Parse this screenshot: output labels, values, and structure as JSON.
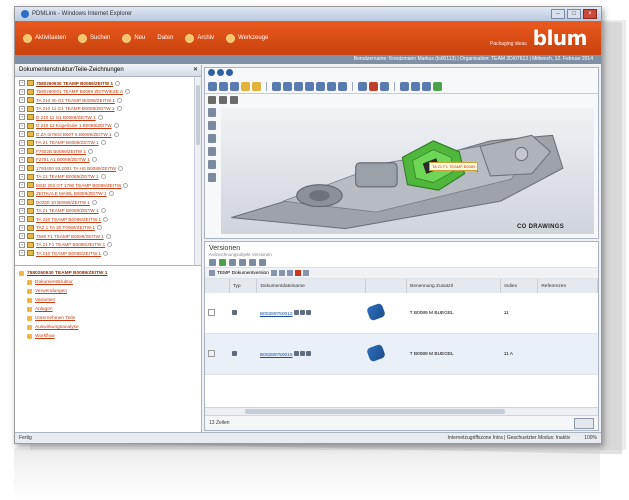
{
  "window": {
    "title": "PDMLink - Windows Internet Explorer"
  },
  "topbar": {
    "menu": [
      {
        "label": "Aktivitaeten"
      },
      {
        "label": "Suchen"
      },
      {
        "label": "Neu"
      },
      {
        "label": "Daten"
      },
      {
        "label": "Archiv"
      },
      {
        "label": "Werkzeuge"
      }
    ],
    "tagline": "Packaging ideas",
    "logo": "blum",
    "info": "Benutzername: Kreutzmann Markus (lo00113) | Organisation: TEAM 2D/07613 | Mittwoch, 12. Februar 2014"
  },
  "left": {
    "header": "Dokumentenstruktur/Teile-Zeichnungen",
    "tree": [
      "7580260930 TEAMP B0089/ZEITW 1",
      "7580260001 TEAMP B0089 ZEITWIEZE A",
      "TA 210 30 G1 TEAMP B0089/ZEITW 1",
      "TA 210 11 G1 TEAMP B0089/ZEITW 1",
      "D 210 11 G1 B0089/ZEITW 1",
      "D 210 12 Kugelzuler 1 B0089/ZEITW",
      "D.ZA 0/7503 B00T 5 B0089/ZEITW 1",
      "FA 21 TEAMP B0089/ZEITW 1",
      "F7502B B0089/ZEITW 1",
      "F2781 A1 B0089/ZEITW 1",
      "1793400 93.2001 TA HS B0089/ZEITW",
      "TA 21 TEAMP B0089/ZEITW 1",
      "MSD 202 GT 1780 TEAMP B0089/ZEITW",
      "ZEITKALE MA/BL B0089/ZEITW 1",
      "D0200 10 B0089/ZEITW 1",
      "TA 21 TEAMP B0089/ZEITW 1",
      "TA 210 TEAMP B0089/ZEITW 1",
      "TAZ 1 FA 30 F0089/ZEITW 1",
      "7580 F1 TEAMP B0089/ZEITW 1",
      "TA 21 F1 TEAMP B0089/ZEITW 1",
      "TA 210 TEAMP B0089/ZEITW 1"
    ],
    "tree2": {
      "root": "7580260930 TEAMP B0089/ZEITW 1",
      "items": [
        "Dokumentstruktur",
        "Verwendungen",
        "Varianten",
        "Anlagen",
        "Unternehmen Teile",
        "Auswirkungsanalyse",
        "Workflow"
      ]
    }
  },
  "viewer": {
    "callout": "TA 21 F1 TEAMP B0089",
    "watermark": "CO DRAWINGS"
  },
  "versions": {
    "title": "Versionen",
    "subtitle": "Aufzeichnungsobjekt Versionen",
    "toolbar_label": "TEMP Dokumentversion",
    "columns": [
      "Typ",
      "Dokumentdateiname",
      "",
      "Benennung Zusatztl",
      "Indiex",
      "Referenzen"
    ],
    "rows": [
      {
        "name": "B00289750012",
        "benennung": "T B0089 M BUEGEL",
        "index": "11"
      },
      {
        "name": "B00289750015",
        "benennung": "T B0089 M BUEGEL",
        "index": "11 A"
      }
    ],
    "footer": "13 Zeilen"
  },
  "statusbar": {
    "left": "Fertig",
    "middle": "Internetzugriffszone Intra | Geschuetzter Modus: Inaktiv",
    "zoom": "100%"
  }
}
